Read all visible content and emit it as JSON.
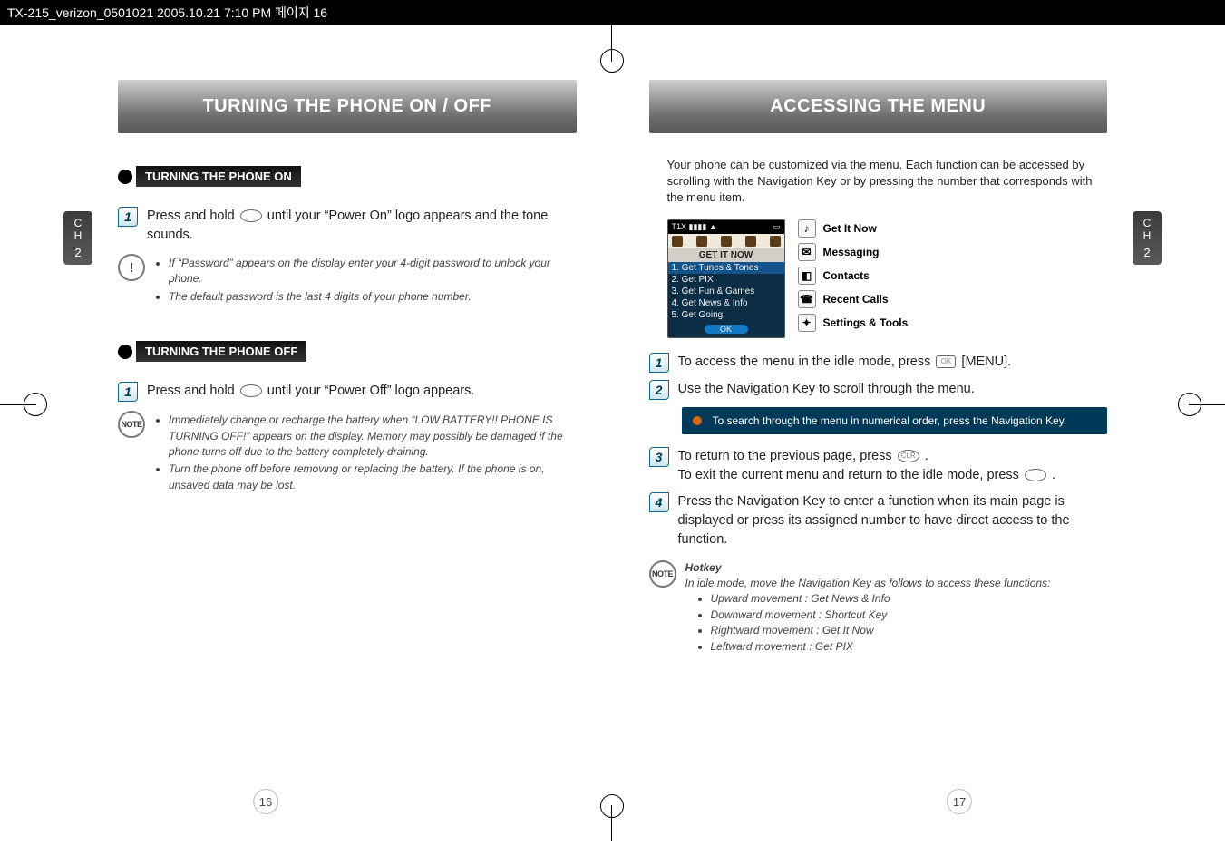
{
  "header_strip": "TX-215_verizon_0501021  2005.10.21  7:10 PM  페이지 16",
  "left": {
    "banner": "TURNING THE PHONE ON / OFF",
    "chapter": {
      "c": "C",
      "h": "H",
      "n": "2"
    },
    "section_on": "TURNING THE PHONE ON",
    "step_on_1": "Press and hold        until your “Power On” logo appears and the tone sounds.",
    "warn_bullets_on": [
      "If “Password” appears on the display enter your 4-digit password to unlock your phone.",
      "The default password is the last 4 digits of your phone number."
    ],
    "section_off": "TURNING THE PHONE OFF",
    "step_off_1": "Press and hold        until your “Power Off” logo appears.",
    "note_bullets_off": [
      "Immediately change or recharge the battery when “LOW BATTERY!! PHONE IS TURNING OFF!” appears on the display. Memory may possibly be damaged if the phone turns off due to the battery completely draining.",
      "Turn the phone off before removing or replacing the battery. If the phone is on, unsaved data may be lost."
    ],
    "page_num": "16"
  },
  "right": {
    "banner": "ACCESSING THE MENU",
    "chapter": {
      "c": "C",
      "h": "H",
      "n": "2"
    },
    "intro": "Your phone can be customized via the menu. Each function can be accessed by scrolling with the Navigation Key or by pressing the number that corresponds with the menu item.",
    "screen": {
      "status_left": "T1X ▮▮▮▮ ▲",
      "status_right": "▭",
      "title": "GET IT NOW",
      "rows": [
        "1. Get Tunes & Tones",
        "2. Get PIX",
        "3. Get Fun & Games",
        "4. Get News & Info",
        "5. Get Going"
      ],
      "ok": "OK"
    },
    "menu_items": [
      {
        "glyph": "♪",
        "label": "Get It Now"
      },
      {
        "glyph": "✉",
        "label": "Messaging"
      },
      {
        "glyph": "◧",
        "label": "Contacts"
      },
      {
        "glyph": "☎",
        "label": "Recent Calls"
      },
      {
        "glyph": "✦",
        "label": "Settings & Tools"
      }
    ],
    "steps": {
      "s1": "To access the menu in the idle mode, press      [MENU].",
      "s2": "Use the Navigation Key to scroll through the menu.",
      "tip": "To search through the menu in numerical order, press the Navigation Key.",
      "s3a": "To return to the previous page, press       .",
      "s3b": "To exit the current menu and return to the idle mode, press        .",
      "s4": "Press the Navigation Key to enter a function when its main page is displayed or press its assigned number to have direct access to the function."
    },
    "hotkey": {
      "title": "Hotkey",
      "intro": "In idle mode, move the Navigation Key as follows to access these functions:",
      "items": [
        "Upward movement : Get News & Info",
        "Downward movement : Shortcut Key",
        "Rightward movement : Get It Now",
        "Leftward movement : Get PIX"
      ]
    },
    "page_num": "17"
  }
}
